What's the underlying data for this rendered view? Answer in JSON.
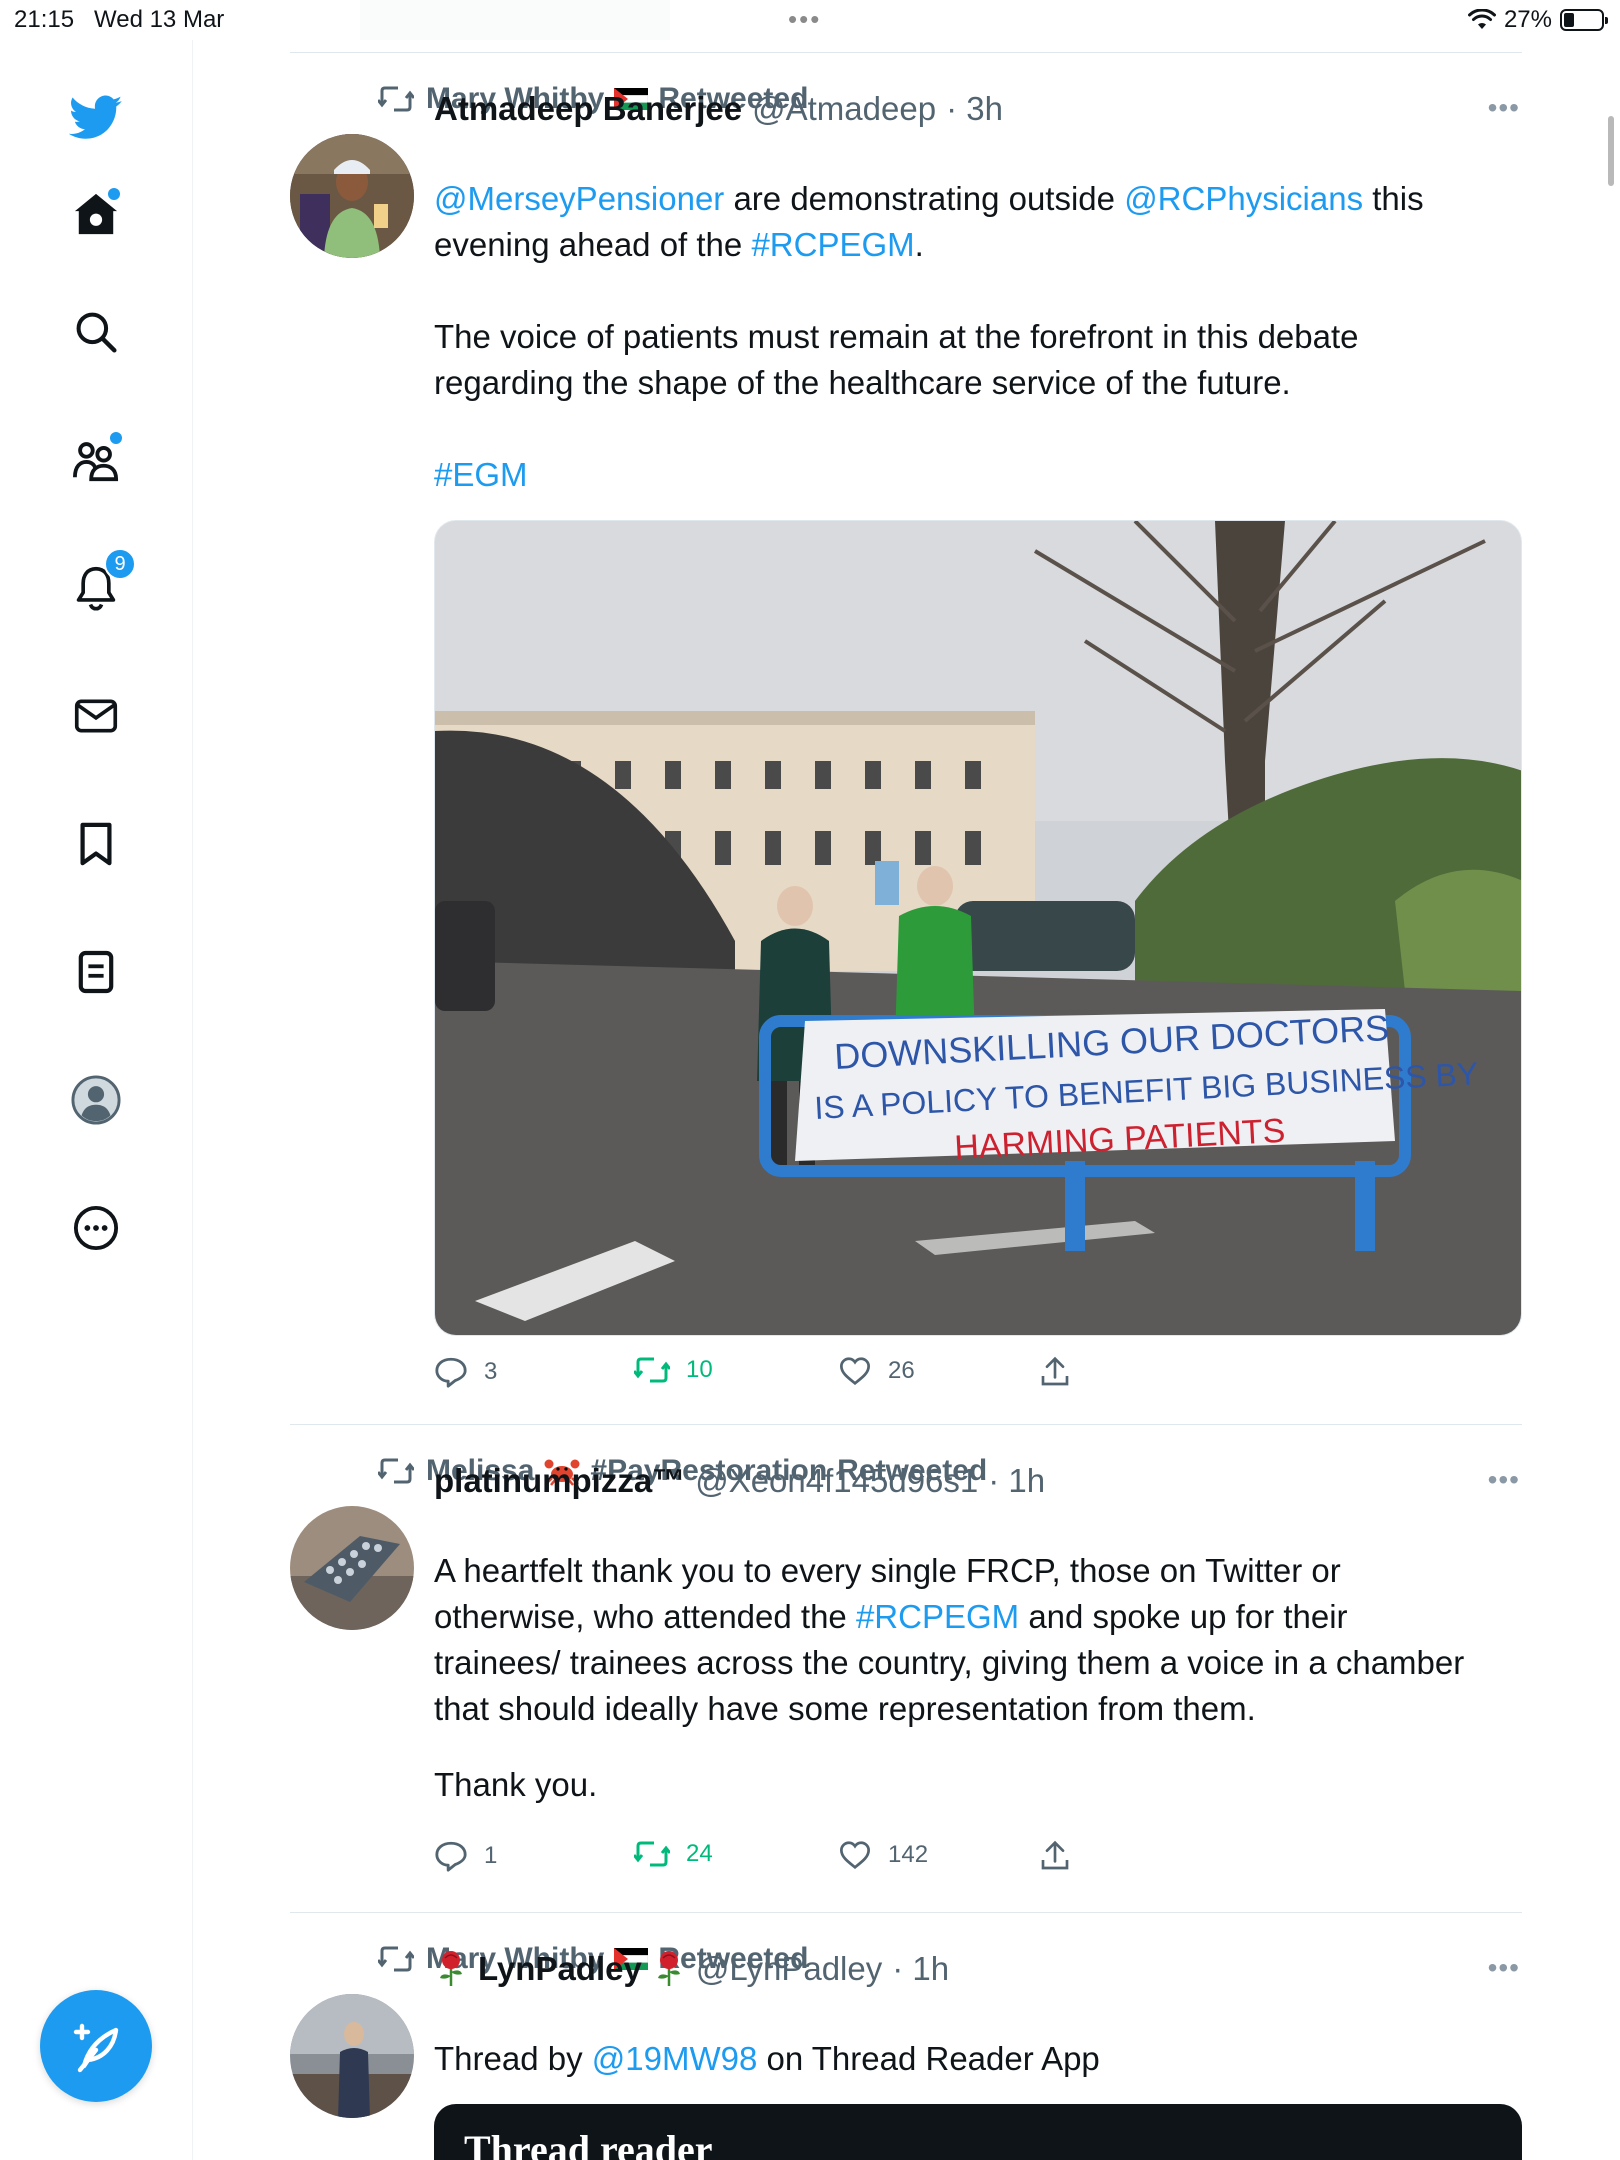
{
  "status_bar": {
    "time": "21:15",
    "date": "Wed 13 Mar",
    "battery": "27%",
    "battery_level": 0.27
  },
  "sidebar": {
    "items": [
      {
        "name": "home",
        "icon": "home-icon"
      },
      {
        "name": "explore",
        "icon": "search-icon"
      },
      {
        "name": "communities",
        "icon": "communities-icon"
      },
      {
        "name": "notifications",
        "icon": "bell-icon",
        "badge": "9"
      },
      {
        "name": "messages",
        "icon": "mail-icon"
      },
      {
        "name": "bookmarks",
        "icon": "bookmark-icon"
      },
      {
        "name": "lists",
        "icon": "list-icon"
      },
      {
        "name": "profile",
        "icon": "profile-icon"
      },
      {
        "name": "more",
        "icon": "more-circle-icon"
      }
    ],
    "compose_icon": "compose-feather-icon"
  },
  "colors": {
    "accent": "#1d9bf0",
    "retweet": "#00ba7c",
    "secondary_text": "#536471"
  },
  "tweets": [
    {
      "retweeted_by": "Mary Whitby",
      "retweeted_suffix": "Retweeted",
      "display_name": "Atmadeep Banerjee",
      "handle": "@Atmadeep",
      "time": "· 3h",
      "text": {
        "l1_m1": "@MerseyPensioner",
        "l1_t1": " are demonstrating outside ",
        "l1_m2": "@RCPhysicians",
        "l1_t2": " this",
        "l2_t1": "evening ahead of the ",
        "l2_h1": "#RCPEGM",
        "l2_t2": ".",
        "p2_l1": "The voice of patients must remain at the forefront in this debate",
        "p2_l2": "regarding the shape of the healthcare service of the future.",
        "p3": "#EGM"
      },
      "banner": {
        "line1": "DOWNSKILLING OUR DOCTORS",
        "line2": "IS A POLICY TO BENEFIT BIG BUSINESS BY",
        "line3": "HARMING PATIENTS"
      },
      "replies": "3",
      "retweets": "10",
      "likes": "26"
    },
    {
      "retweeted_by": "Melissa",
      "retweeted_hashtag": "#PayRestoration",
      "retweeted_suffix": "Retweeted",
      "display_name": "platinumpizza™",
      "handle": "@Xeon4f145d96s1",
      "time": "· 1h",
      "text": {
        "l1": "A heartfelt thank you to every single FRCP, those on Twitter or",
        "l2_t1": "otherwise, who attended the ",
        "l2_h1": "#RCPEGM",
        "l2_t2": " and spoke up for their",
        "l3": "trainees/ trainees across the country, giving them a voice in a chamber",
        "l4": "that should ideally have some representation from them.",
        "p2": "Thank you."
      },
      "replies": "1",
      "retweets": "24",
      "likes": "142"
    },
    {
      "retweeted_by": "Mary Whitby",
      "retweeted_suffix": "Retweeted",
      "display_name": "LynPadley",
      "handle": "@LynPadley",
      "time": "· 1h",
      "text": {
        "t1": "Thread by ",
        "m1": "@19MW98",
        "t2": " on Thread Reader App"
      },
      "card_title": "Thread reader"
    }
  ]
}
